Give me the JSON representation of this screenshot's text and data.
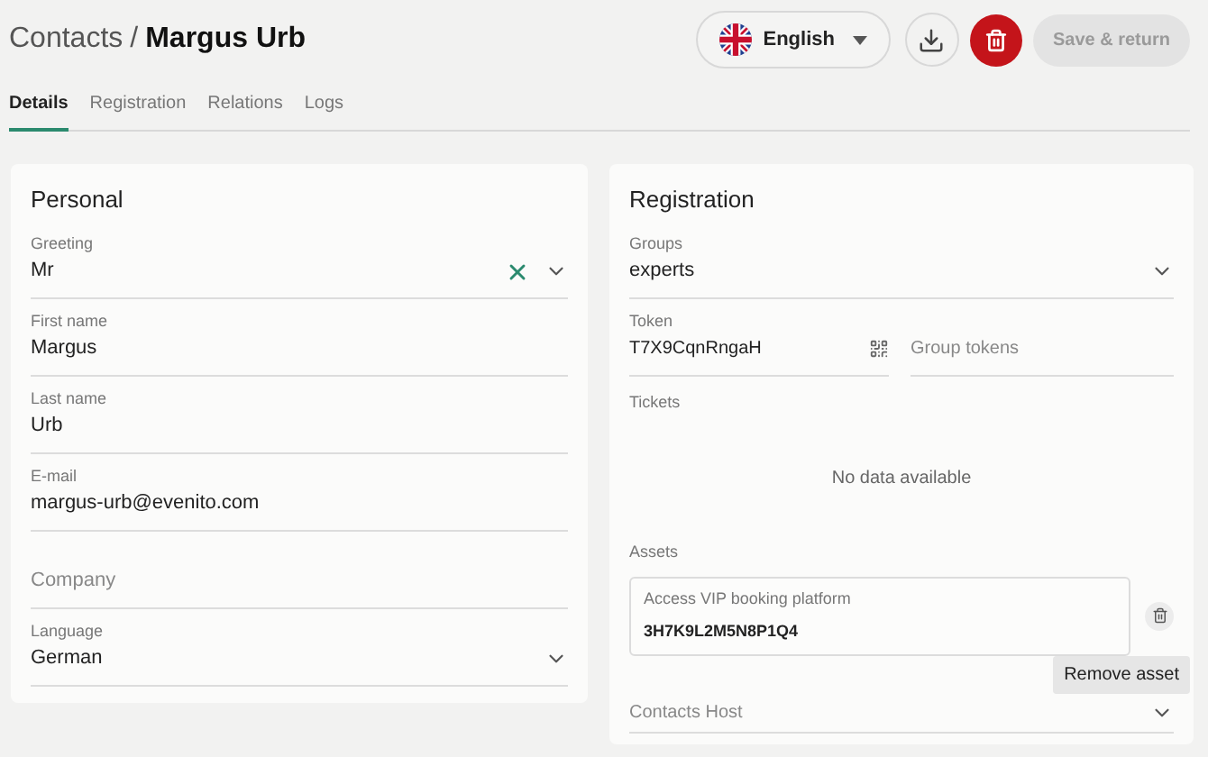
{
  "breadcrumb": {
    "parent": "Contacts",
    "separator": "/",
    "current": "Margus Urb"
  },
  "language_button": {
    "label": "English"
  },
  "save_button": {
    "label": "Save & return",
    "disabled": true
  },
  "tabs": [
    {
      "label": "Details",
      "selected": true
    },
    {
      "label": "Registration",
      "selected": false
    },
    {
      "label": "Relations",
      "selected": false
    },
    {
      "label": "Logs",
      "selected": false
    }
  ],
  "personal": {
    "title": "Personal",
    "fields": [
      {
        "kind": "select",
        "label": "Greeting",
        "value": "Mr",
        "clearable": true
      },
      {
        "kind": "text",
        "label": "First name",
        "value": "Margus"
      },
      {
        "kind": "text",
        "label": "Last name",
        "value": "Urb"
      },
      {
        "kind": "text",
        "label": "E-mail",
        "value": "margus-urb@evenito.com"
      },
      {
        "kind": "text",
        "placeholder": "Company"
      },
      {
        "kind": "select",
        "label": "Language",
        "value": "German"
      }
    ]
  },
  "registration": {
    "title": "Registration",
    "groups": {
      "label": "Groups",
      "value": "experts"
    },
    "token": {
      "label": "Token",
      "value": "T7X9CqnRngaH"
    },
    "group_tokens": {
      "placeholder": "Group tokens"
    },
    "tickets": {
      "label": "Tickets",
      "empty_text": "No data available"
    },
    "assets": {
      "label": "Assets",
      "items": [
        {
          "name": "Access VIP booking platform",
          "code": "3H7K9L2M5N8P1Q4"
        }
      ],
      "tooltip": "Remove asset"
    },
    "contacts_host": {
      "placeholder": "Contacts Host"
    }
  }
}
